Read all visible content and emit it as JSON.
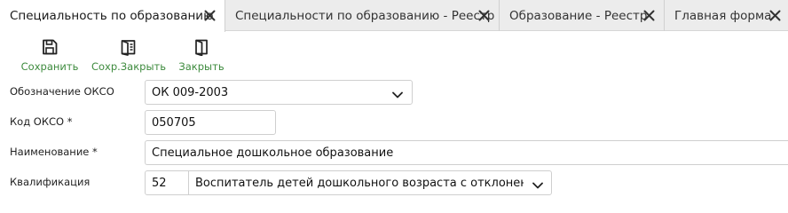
{
  "tabs": [
    {
      "label": "Специальность по образованию",
      "active": true
    },
    {
      "label": "Специальности по образованию - Реестр",
      "active": false
    },
    {
      "label": "Образование - Реестр",
      "active": false
    },
    {
      "label": "Главная форма",
      "active": false
    }
  ],
  "toolbar": {
    "save_label": "Сохранить",
    "save_close_label": "Сохр.Закрыть",
    "close_label": "Закрыть"
  },
  "form": {
    "okso_designation": {
      "label": "Обозначение ОКСО",
      "value": "ОК 009-2003"
    },
    "okso_code": {
      "label": "Код ОКСО *",
      "value": "050705"
    },
    "name": {
      "label": "Наименование *",
      "value": "Специальное дошкольное образование"
    },
    "qualification": {
      "label": "Квалификация",
      "code": "52",
      "value": "Воспитатель детей дошкольного возраста с отклонениями"
    }
  },
  "colors": {
    "accent": "#3e8b3e",
    "tab_bar": "#ececec",
    "border": "#cfcfcf"
  }
}
